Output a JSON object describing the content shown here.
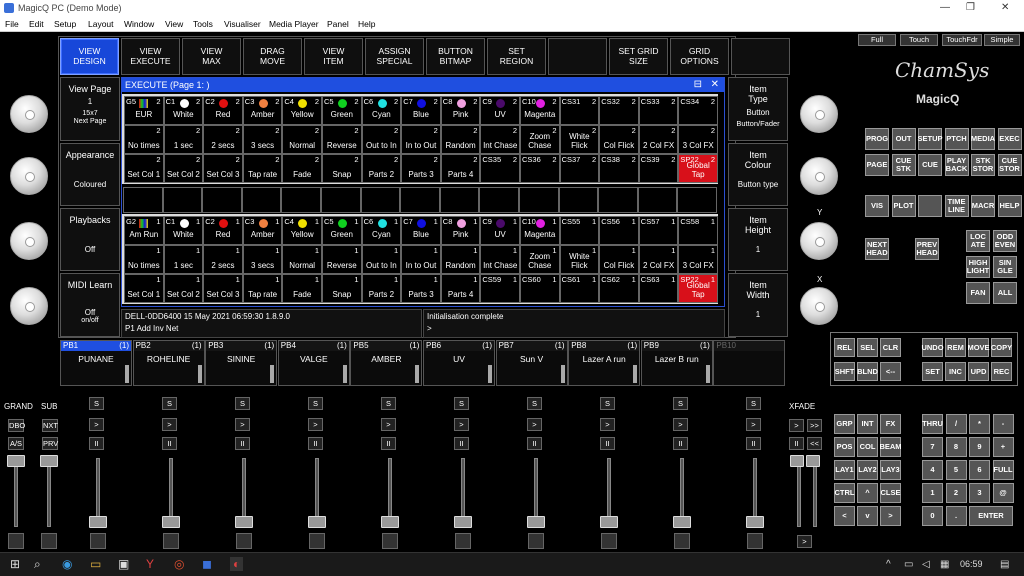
{
  "window": {
    "title": "MagicQ PC (Demo Mode)",
    "min": "—",
    "max": "❐",
    "close": "✕"
  },
  "menu": [
    "File",
    "Edit",
    "Setup",
    "Layout",
    "Window",
    "View",
    "Tools",
    "Visualiser",
    "Media Player",
    "Panel",
    "Help"
  ],
  "modes": [
    "VIEW\nDESIGN",
    "VIEW\nEXECUTE",
    "VIEW\nMAX",
    "DRAG\nMOVE",
    "VIEW\nITEM",
    "ASSIGN\nSPECIAL",
    "BUTTON\nBITMAP",
    "SET\nREGION",
    "",
    "SET GRID\nSIZE",
    "GRID\nOPTIONS",
    ""
  ],
  "left": {
    "view_page": {
      "title": "View Page",
      "value": "1",
      "extra": "15x7",
      "sub": "Next Page"
    },
    "appearance": {
      "title": "Appearance",
      "value": "Coloured"
    },
    "playbacks": {
      "title": "Playbacks",
      "value": "Off"
    },
    "midi": {
      "title": "MIDI Learn",
      "value": "Off",
      "sub": "on/off"
    }
  },
  "right": {
    "type": {
      "title": "Item\nType",
      "value": "Button",
      "sub": "Button/Fader"
    },
    "colour": {
      "title": "Item\nColour",
      "value": "Button type"
    },
    "height": {
      "title": "Item\nHeight",
      "value": "1"
    },
    "width": {
      "title": "Item\nWidth",
      "value": "1"
    }
  },
  "exec": {
    "title": "EXECUTE (Page 1: )",
    "grid1": [
      [
        [
          "G5",
          "EUR",
          "2",
          "c"
        ],
        [
          "C1",
          "White",
          "2",
          "#ffffff"
        ],
        [
          "C2",
          "Red",
          "2",
          "#e01010"
        ],
        [
          "C3",
          "Amber",
          "2",
          "#f08040"
        ],
        [
          "C4",
          "Yellow",
          "2",
          "#f0e000"
        ],
        [
          "C5",
          "Green",
          "2",
          "#10d020"
        ],
        [
          "C6",
          "Cyan",
          "2",
          "#20e0e0"
        ],
        [
          "C7",
          "Blue",
          "2",
          "#1010e0"
        ],
        [
          "C8",
          "Pink",
          "2",
          "#f0a0e0"
        ],
        [
          "C9",
          "UV",
          "2",
          "#4a0a6a"
        ],
        [
          "C10",
          "Magenta",
          "2",
          "#e020e0"
        ],
        [
          "CS31",
          "",
          "2",
          ""
        ],
        [
          "CS32",
          "",
          "2",
          ""
        ],
        [
          "CS33",
          "",
          "2",
          ""
        ],
        [
          "CS34",
          "",
          "2",
          ""
        ]
      ],
      [
        [
          "",
          "No times",
          "2",
          ""
        ],
        [
          "",
          "1 sec",
          "2",
          ""
        ],
        [
          "",
          "2 secs",
          "2",
          ""
        ],
        [
          "",
          "3 secs",
          "2",
          ""
        ],
        [
          "",
          "Normal",
          "2",
          ""
        ],
        [
          "",
          "Reverse",
          "2",
          ""
        ],
        [
          "",
          "Out to In",
          "2",
          ""
        ],
        [
          "",
          "In to Out",
          "2",
          ""
        ],
        [
          "",
          "Random",
          "2",
          ""
        ],
        [
          "",
          "Int Chase",
          "2",
          ""
        ],
        [
          "",
          "Zoom Chase",
          "2",
          ""
        ],
        [
          "",
          "White Flick",
          "2",
          ""
        ],
        [
          "",
          "Col Flick",
          "2",
          ""
        ],
        [
          "",
          "2 Col FX",
          "2",
          ""
        ],
        [
          "",
          "3 Col FX",
          "2",
          ""
        ]
      ],
      [
        [
          "",
          "Set Col 1",
          "2",
          ""
        ],
        [
          "",
          "Set Col 2",
          "2",
          ""
        ],
        [
          "",
          "Set Col 3",
          "2",
          ""
        ],
        [
          "",
          "Tap rate",
          "2",
          ""
        ],
        [
          "",
          "Fade",
          "2",
          ""
        ],
        [
          "",
          "Snap",
          "2",
          ""
        ],
        [
          "",
          "Parts 2",
          "2",
          ""
        ],
        [
          "",
          "Parts 3",
          "2",
          ""
        ],
        [
          "",
          "Parts 4",
          "2",
          ""
        ],
        [
          "CS35",
          "",
          "2",
          ""
        ],
        [
          "CS36",
          "",
          "2",
          ""
        ],
        [
          "CS37",
          "",
          "2",
          ""
        ],
        [
          "CS38",
          "",
          "2",
          ""
        ],
        [
          "CS39",
          "",
          "2",
          ""
        ],
        [
          "SP22",
          "Global Tap",
          "2",
          "red"
        ]
      ]
    ],
    "grid2": [
      [
        [
          "G2",
          "Am Run",
          "1",
          "c"
        ],
        [
          "C1",
          "White",
          "1",
          "#ffffff"
        ],
        [
          "C2",
          "Red",
          "1",
          "#e01010"
        ],
        [
          "C3",
          "Amber",
          "1",
          "#f08040"
        ],
        [
          "C4",
          "Yellow",
          "1",
          "#f0e000"
        ],
        [
          "C5",
          "Green",
          "1",
          "#10d020"
        ],
        [
          "C6",
          "Cyan",
          "1",
          "#20e0e0"
        ],
        [
          "C7",
          "Blue",
          "1",
          "#1010e0"
        ],
        [
          "C8",
          "Pink",
          "1",
          "#f0a0e0"
        ],
        [
          "C9",
          "UV",
          "1",
          "#4a0a6a"
        ],
        [
          "C10",
          "Magenta",
          "1",
          "#e020e0"
        ],
        [
          "CS55",
          "",
          "1",
          ""
        ],
        [
          "CS56",
          "",
          "1",
          ""
        ],
        [
          "CS57",
          "",
          "1",
          ""
        ],
        [
          "CS58",
          "",
          "1",
          ""
        ]
      ],
      [
        [
          "",
          "No times",
          "1",
          ""
        ],
        [
          "",
          "1 sec",
          "1",
          ""
        ],
        [
          "",
          "2 secs",
          "1",
          ""
        ],
        [
          "",
          "3 secs",
          "1",
          ""
        ],
        [
          "",
          "Normal",
          "1",
          ""
        ],
        [
          "",
          "Reverse",
          "1",
          ""
        ],
        [
          "",
          "Out to In",
          "1",
          ""
        ],
        [
          "",
          "In to Out",
          "1",
          ""
        ],
        [
          "",
          "Random",
          "1",
          ""
        ],
        [
          "",
          "Int Chase",
          "1",
          ""
        ],
        [
          "",
          "Zoom Chase",
          "1",
          ""
        ],
        [
          "",
          "White Flick",
          "1",
          ""
        ],
        [
          "",
          "Col Flick",
          "1",
          ""
        ],
        [
          "",
          "2 Col FX",
          "1",
          ""
        ],
        [
          "",
          "3 Col FX",
          "1",
          ""
        ]
      ],
      [
        [
          "",
          "Set Col 1",
          "1",
          ""
        ],
        [
          "",
          "Set Col 2",
          "1",
          ""
        ],
        [
          "",
          "Set Col 3",
          "1",
          ""
        ],
        [
          "",
          "Tap rate",
          "1",
          ""
        ],
        [
          "",
          "Fade",
          "1",
          ""
        ],
        [
          "",
          "Snap",
          "1",
          ""
        ],
        [
          "",
          "Parts 2",
          "1",
          ""
        ],
        [
          "",
          "Parts 3",
          "1",
          ""
        ],
        [
          "",
          "Parts 4",
          "1",
          ""
        ],
        [
          "CS59",
          "",
          "1",
          ""
        ],
        [
          "CS60",
          "",
          "1",
          ""
        ],
        [
          "CS61",
          "",
          "1",
          ""
        ],
        [
          "CS62",
          "",
          "1",
          ""
        ],
        [
          "CS63",
          "",
          "1",
          ""
        ],
        [
          "SP22",
          "Global Tap",
          "1",
          "red"
        ]
      ]
    ]
  },
  "status": {
    "line1": "DELL-0DD6400 15 May 2021 06:59:30 1.8.9.0",
    "line2": "P1  Add Inv Net",
    "msg": "Initialisation complete",
    "prompt": ">"
  },
  "playbacks": [
    {
      "id": "PB1",
      "count": "(1)",
      "name": "PUNANE"
    },
    {
      "id": "PB2",
      "count": "(1)",
      "name": "ROHELINE"
    },
    {
      "id": "PB3",
      "count": "(1)",
      "name": "SININE"
    },
    {
      "id": "PB4",
      "count": "(1)",
      "name": "VALGE"
    },
    {
      "id": "PB5",
      "count": "(1)",
      "name": "AMBER"
    },
    {
      "id": "PB6",
      "count": "(1)",
      "name": "UV"
    },
    {
      "id": "PB7",
      "count": "(1)",
      "name": "Sun V"
    },
    {
      "id": "PB8",
      "count": "(1)",
      "name": "Lazer A run"
    },
    {
      "id": "PB9",
      "count": "(1)",
      "name": "Lazer B run"
    },
    {
      "id": "PB10",
      "count": "",
      "name": ""
    }
  ],
  "faders": {
    "grand": "GRAND",
    "sub": "SUB",
    "dbo": "DBO",
    "nxt": "NXT",
    "as": "A/S",
    "prv": "PRV",
    "xfade": "XFADE",
    "s": "S",
    "go": ">",
    "pause": "II",
    "ff": ">>",
    "rw": "<<"
  },
  "brand": {
    "logo": "ChamSys",
    "model": "MagicQ"
  },
  "tabs": [
    "Full",
    "Touch",
    "TouchFdr",
    "Simple"
  ],
  "axis": {
    "y": "Y",
    "x": "X"
  },
  "panel1": [
    "PROG",
    "OUT",
    "SETUP",
    "PTCH",
    "MEDIA",
    "EXEC",
    "PAGE",
    "CUE\nSTK",
    "CUE",
    "PLAY\nBACK",
    "STK\nSTOR",
    "CUE\nSTOR"
  ],
  "panel2": [
    "VIS",
    "PLOT",
    "",
    "TIME\nLINE",
    "MACR",
    "HELP"
  ],
  "panel3": [
    "NEXT\nHEAD",
    "PREV\nHEAD",
    "LOC\nATE",
    "ODD\nEVEN",
    "HIGH\nLIGHT",
    "SIN\nGLE",
    "FAN",
    "ALL"
  ],
  "panel4": [
    "REL",
    "SEL",
    "CLR",
    "UNDO",
    "REM",
    "MOVE",
    "COPY",
    "SHFT",
    "BLND",
    "<--",
    "SET",
    "INC",
    "UPD",
    "REC"
  ],
  "panel5": [
    "GRP",
    "INT",
    "FX",
    "POS",
    "COL",
    "BEAM",
    "LAY1",
    "LAY2",
    "LAY3",
    "CTRL",
    "^",
    "CLSE",
    "<",
    "v",
    ">"
  ],
  "keypad": [
    "THRU",
    "/",
    "*",
    "-",
    "7",
    "8",
    "9",
    "+",
    "4",
    "5",
    "6",
    "FULL",
    "1",
    "2",
    "3",
    "@",
    "0",
    ".",
    "ENTER"
  ],
  "taskbar": {
    "time": "06:59"
  }
}
